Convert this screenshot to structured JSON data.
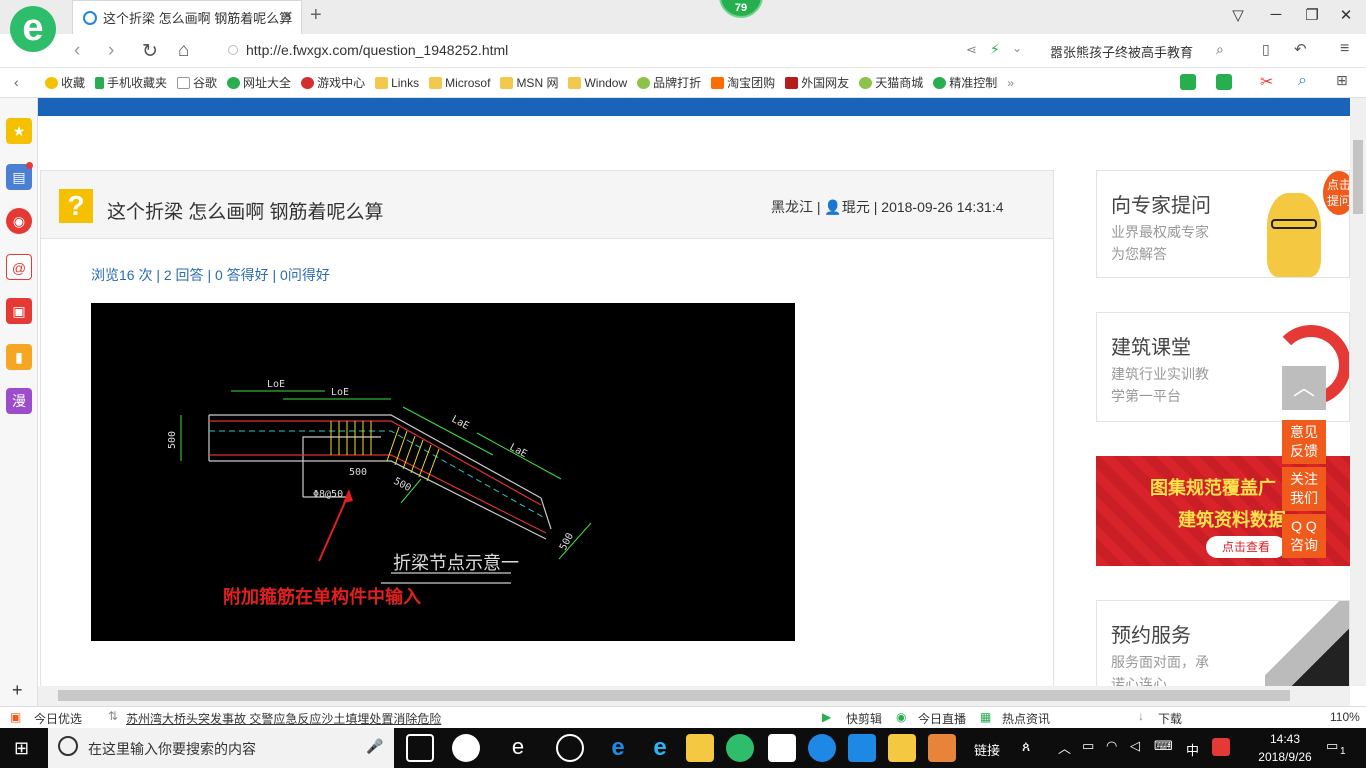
{
  "tab": {
    "title": "这个折梁 怎么画啊 钢筋着呢么算",
    "close": "✕",
    "new": "+"
  },
  "badge": "79",
  "browser": {
    "logo": "e",
    "url": "http://e.fwxgx.com/question_1948252.html",
    "search_hint": "嚣张熊孩子终被高手教育"
  },
  "bookmarks": [
    "收藏",
    "手机收藏夹",
    "谷歌",
    "网址大全",
    "游戏中心",
    "Links",
    "Microsof",
    "MSN 网",
    "Window",
    "品牌打折",
    "淘宝团购",
    "外国网友",
    "天猫商城",
    "精准控制"
  ],
  "question": {
    "title": "这个折梁 怎么画啊 钢筋着呢么算",
    "region": "黑龙江",
    "user": "琨元",
    "time": "2018-09-26 14:31:4",
    "stats": "浏览16 次 | 2 回答 | 0 答得好 | 0问得好"
  },
  "cad": {
    "label_loe1": "LoE",
    "label_loe2": "LoE",
    "label_lae1": "LaE",
    "label_lae2": "LaE",
    "dim_500_left": "500",
    "dim_500_mid": "500",
    "dim_500_diag": "500",
    "dim_500_right": "500",
    "stirrup": "Φ8@50",
    "drawing_title": "折梁节点示意一",
    "note": "附加箍筋在单构件中输入"
  },
  "right": {
    "expert_title": "向专家提问",
    "expert_sub1": "业界最权威专家",
    "expert_sub2": "为您解答",
    "expert_bubble": "点击提问",
    "class_title": "建筑课堂",
    "class_sub1": "建筑行业实训教",
    "class_sub2": "学第一平台",
    "banner_line1": "图集规范覆盖广",
    "banner_line2": "建筑资料数据",
    "banner_btn": "点击查看",
    "service_title": "预约服务",
    "service_sub1": "服务面对面，承",
    "service_sub2": "诺心连心"
  },
  "float": {
    "top": "︿",
    "feedback1": "意见",
    "feedback2": "反馈",
    "follow1": "关注",
    "follow2": "我们",
    "qq1": "Q Q",
    "qq2": "咨询"
  },
  "status": {
    "today": "今日优选",
    "news": "苏州湾大桥头突发事故 交警应急反应沙土填埋处置消除危险",
    "clip": "快剪辑",
    "live": "今日直播",
    "hot": "热点资讯",
    "download": "下载",
    "zoom": "110%"
  },
  "taskbar": {
    "search": "在这里输入你要搜索的内容",
    "links": "链接",
    "time": "14:43",
    "date": "2018/9/26",
    "ime": "中",
    "notif": "1"
  }
}
